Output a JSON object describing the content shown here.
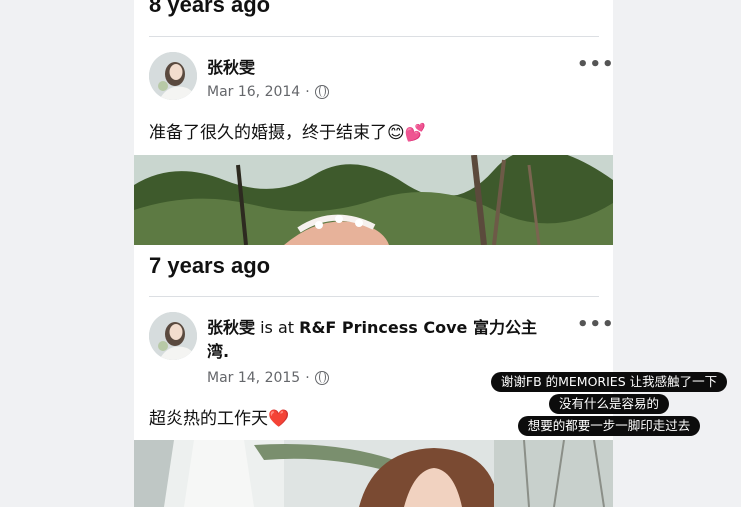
{
  "sections": [
    {
      "header": "8 years ago",
      "post": {
        "author": "张秋雯",
        "location_prefix": "",
        "location": "",
        "date": "Mar 16, 2014",
        "text": "准备了很久的婚摄，终于结束了😊💕",
        "more_icon": "more-horizontal-icon",
        "privacy_icon": "globe-icon"
      }
    },
    {
      "header": "7 years ago",
      "post": {
        "author": "张秋雯",
        "location_prefix": " is at ",
        "location": "R&F Princess Cove 富力公主",
        "location_cont": "湾.",
        "date": "Mar 14, 2015",
        "text": "超炎热的工作天❤️",
        "more_icon": "more-horizontal-icon",
        "privacy_icon": "globe-icon"
      }
    }
  ],
  "overlay_caption": [
    "谢谢FB 的MEMORIES 让我感触了一下",
    "没有什么是容易的",
    "想要的都要一步一脚印走过去"
  ],
  "more_label": "•••",
  "separator": "·",
  "colors": {
    "background": "#eef0f2",
    "card": "#ffffff",
    "muted_text": "#65676b",
    "caption_bg": "#0c0c0c"
  }
}
